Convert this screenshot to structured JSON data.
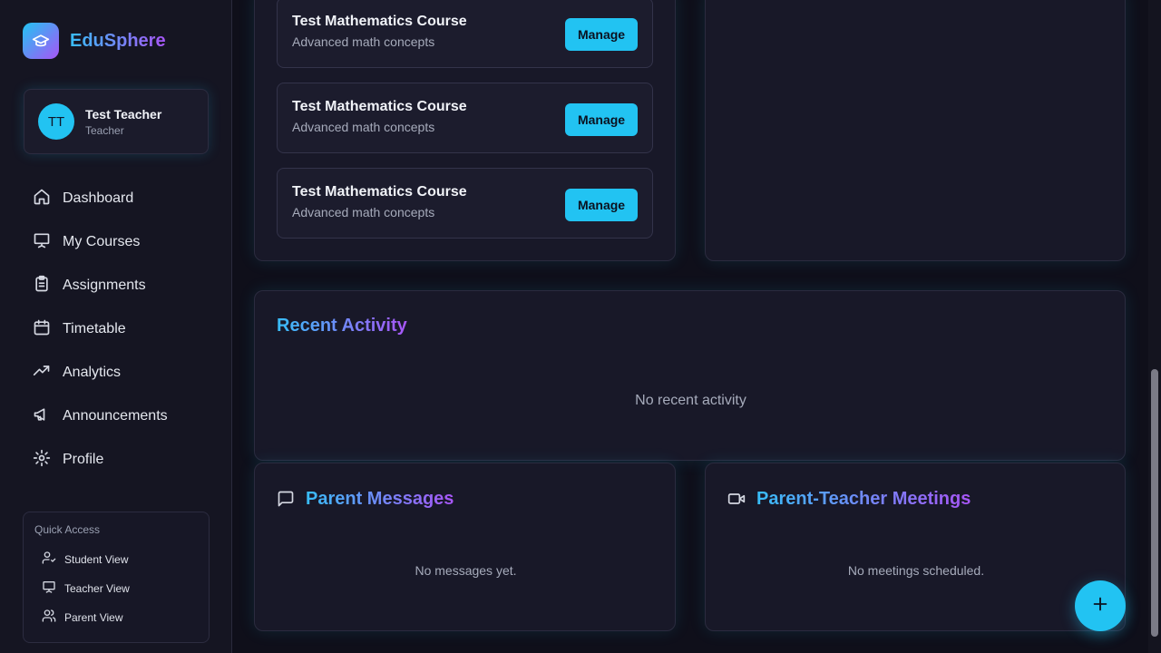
{
  "brand": {
    "name": "EduSphere",
    "logo_icon": "graduation-cap-icon"
  },
  "user": {
    "initials": "TT",
    "name": "Test Teacher",
    "role": "Teacher"
  },
  "nav": {
    "items": [
      {
        "label": "Dashboard",
        "icon": "home-icon"
      },
      {
        "label": "My Courses",
        "icon": "presentation-icon"
      },
      {
        "label": "Assignments",
        "icon": "clipboard-icon"
      },
      {
        "label": "Timetable",
        "icon": "calendar-icon"
      },
      {
        "label": "Analytics",
        "icon": "trending-up-icon"
      },
      {
        "label": "Announcements",
        "icon": "megaphone-icon"
      },
      {
        "label": "Profile",
        "icon": "settings-icon"
      }
    ]
  },
  "quick_access": {
    "title": "Quick Access",
    "items": [
      {
        "label": "Student View",
        "icon": "user-check-icon"
      },
      {
        "label": "Teacher View",
        "icon": "presentation-icon"
      },
      {
        "label": "Parent View",
        "icon": "users-icon"
      }
    ]
  },
  "courses": [
    {
      "title": "Test Mathematics Course",
      "subtitle": "Advanced math concepts",
      "action": "Manage"
    },
    {
      "title": "Test Mathematics Course",
      "subtitle": "Advanced math concepts",
      "action": "Manage"
    },
    {
      "title": "Test Mathematics Course",
      "subtitle": "Advanced math concepts",
      "action": "Manage"
    }
  ],
  "recent_activity": {
    "title": "Recent Activity",
    "empty": "No recent activity"
  },
  "parent_messages": {
    "title": "Parent Messages",
    "empty": "No messages yet.",
    "icon": "message-square-icon"
  },
  "meetings": {
    "title": "Parent-Teacher Meetings",
    "empty": "No meetings scheduled.",
    "icon": "video-icon"
  },
  "fab": {
    "icon": "plus-icon"
  },
  "colors": {
    "accent": "#22c3f2",
    "gradient_end": "#a855f7",
    "background": "#0f0f1a",
    "card": "#181828"
  }
}
